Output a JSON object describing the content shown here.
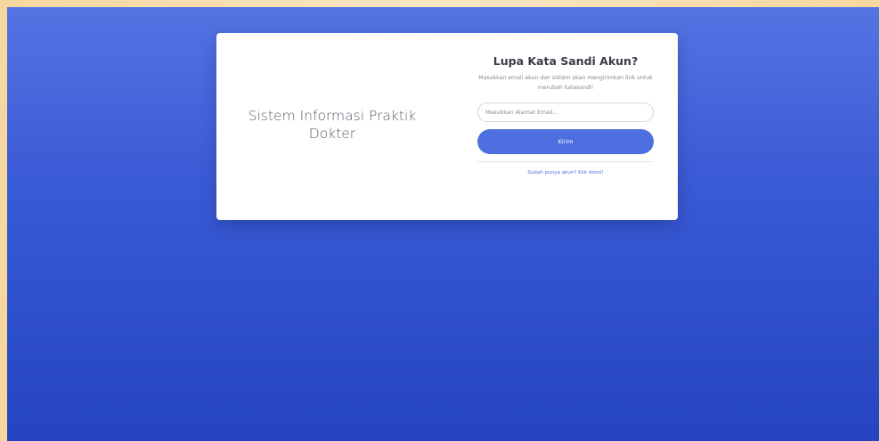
{
  "app": {
    "brand_title": "Sistem Informasi Praktik Dokter"
  },
  "forgot_password": {
    "title": "Lupa Kata Sandi Akun?",
    "description": "Masukkan email akun dan sistem akan mengirimkan link untuk merubah katasandi!",
    "email_placeholder": "Masukkan Alamat Email...",
    "email_value": "",
    "submit_label": "Kirim",
    "login_link_label": "Sudah punya akun? Klik disini!"
  },
  "colors": {
    "background_top": "#5573e2",
    "background_bottom": "#2444c0",
    "primary_button": "#4e6fe0",
    "link": "#4e73df"
  }
}
